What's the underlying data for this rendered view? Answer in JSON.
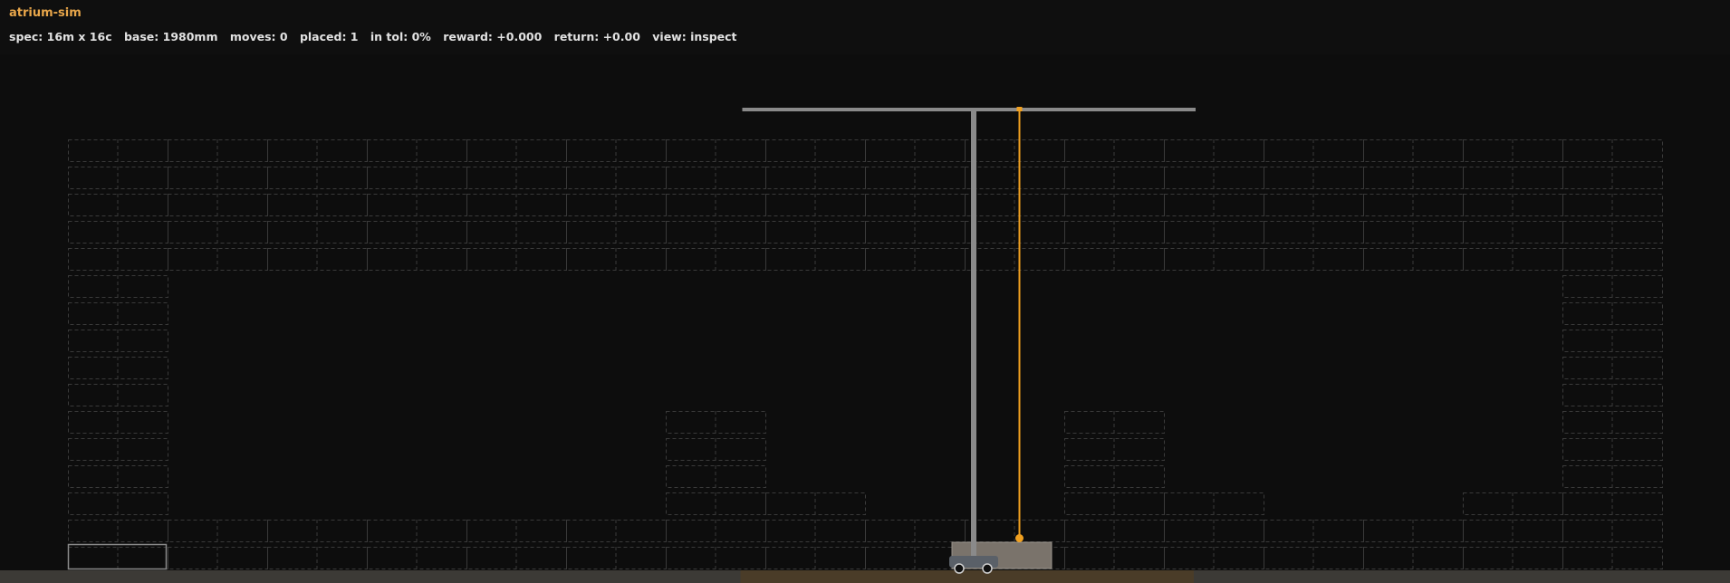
{
  "app": {
    "title": "atrium-sim"
  },
  "status": {
    "spec": "spec: 16m x 16c",
    "base": "base: 1980mm",
    "moves": "moves: 0",
    "placed": "placed: 1",
    "in_tol": "in tol: 0%",
    "reward": "reward: +0.000",
    "return": "return: +0.00",
    "view": "view: inspect"
  },
  "colors": {
    "background": "#0d0d0d",
    "accent": "#e8a64a",
    "text": "#e2e2e2",
    "crane_steel": "#8a8a8a",
    "hoist_line": "#f0a020",
    "ghost_block": "#3a3a3a",
    "placed_block": "#7a736b",
    "ground": "#3c3a36",
    "ground_highlight": "#4a3c28"
  },
  "scene": {
    "columns": 16,
    "rows": 16,
    "footprint": [
      "1111111111111111",
      "1111111111111111",
      "1111111111111111",
      "1111111111111111",
      "1111111111111111",
      "1000000000000001",
      "1000000000000001",
      "1000000000000001",
      "1000000000000001",
      "1000000000000001",
      "1000001000100001",
      "1000001000100001",
      "1000001000100001",
      "1000001100110011",
      "1111111111111111",
      "1111111111111111"
    ],
    "selected_cell": {
      "row": 15,
      "col": 0
    },
    "placed_block": {
      "row": 15,
      "col": 9
    },
    "crane": {
      "mast_col": 9.1,
      "jib_from_col": 6.75,
      "jib_to_col": 11.3,
      "hook_col": 9.55,
      "hook_row": 14.95,
      "rail_from_col": 6.75,
      "rail_to_col": 11.3
    }
  }
}
